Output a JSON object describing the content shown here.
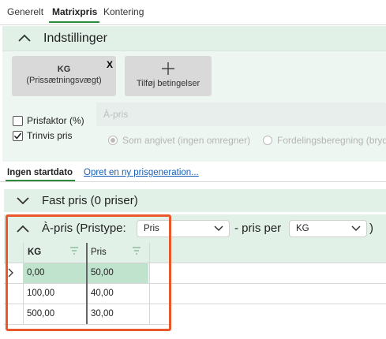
{
  "tabs": [
    {
      "label": "Generelt"
    },
    {
      "label": "Matrixpris"
    },
    {
      "label": "Kontering"
    }
  ],
  "settings": {
    "title": "Indstillinger",
    "condition": {
      "line1": "KG",
      "line2": "(Prissætningsvægt)",
      "remove": "X"
    },
    "add_condition": {
      "plus": "+",
      "label": "Tilføj betingelser"
    },
    "apris_label": "À-pris",
    "prisfaktor": {
      "label": "Prisfaktor (%)",
      "checked": false
    },
    "trinvis": {
      "label": "Trinvis pris",
      "checked": true
    },
    "radio_options": [
      {
        "label": "Som angivet (ingen omregner)",
        "selected": true
      },
      {
        "label": "Fordelingsberegning (bryd"
      }
    ]
  },
  "subtabs": {
    "active": "Ingen startdato",
    "link": "Opret en ny prisgeneration..."
  },
  "fast_pris": {
    "title": "Fast pris (0 priser)"
  },
  "apris_section": {
    "title_prefix": "À-pris (Pristype:",
    "pristype": "Pris",
    "middle": "- pris per",
    "unit": "KG",
    "suffix": ")"
  },
  "grid": {
    "columns": [
      "KG",
      "Pris"
    ],
    "rows": [
      [
        "0,00",
        "50,00"
      ],
      [
        "100,00",
        "40,00"
      ],
      [
        "500,00",
        "30,00"
      ]
    ]
  },
  "colors": {
    "accent": "#2e8b3e",
    "highlight": "#e8582b",
    "link": "#1a5fb4"
  }
}
